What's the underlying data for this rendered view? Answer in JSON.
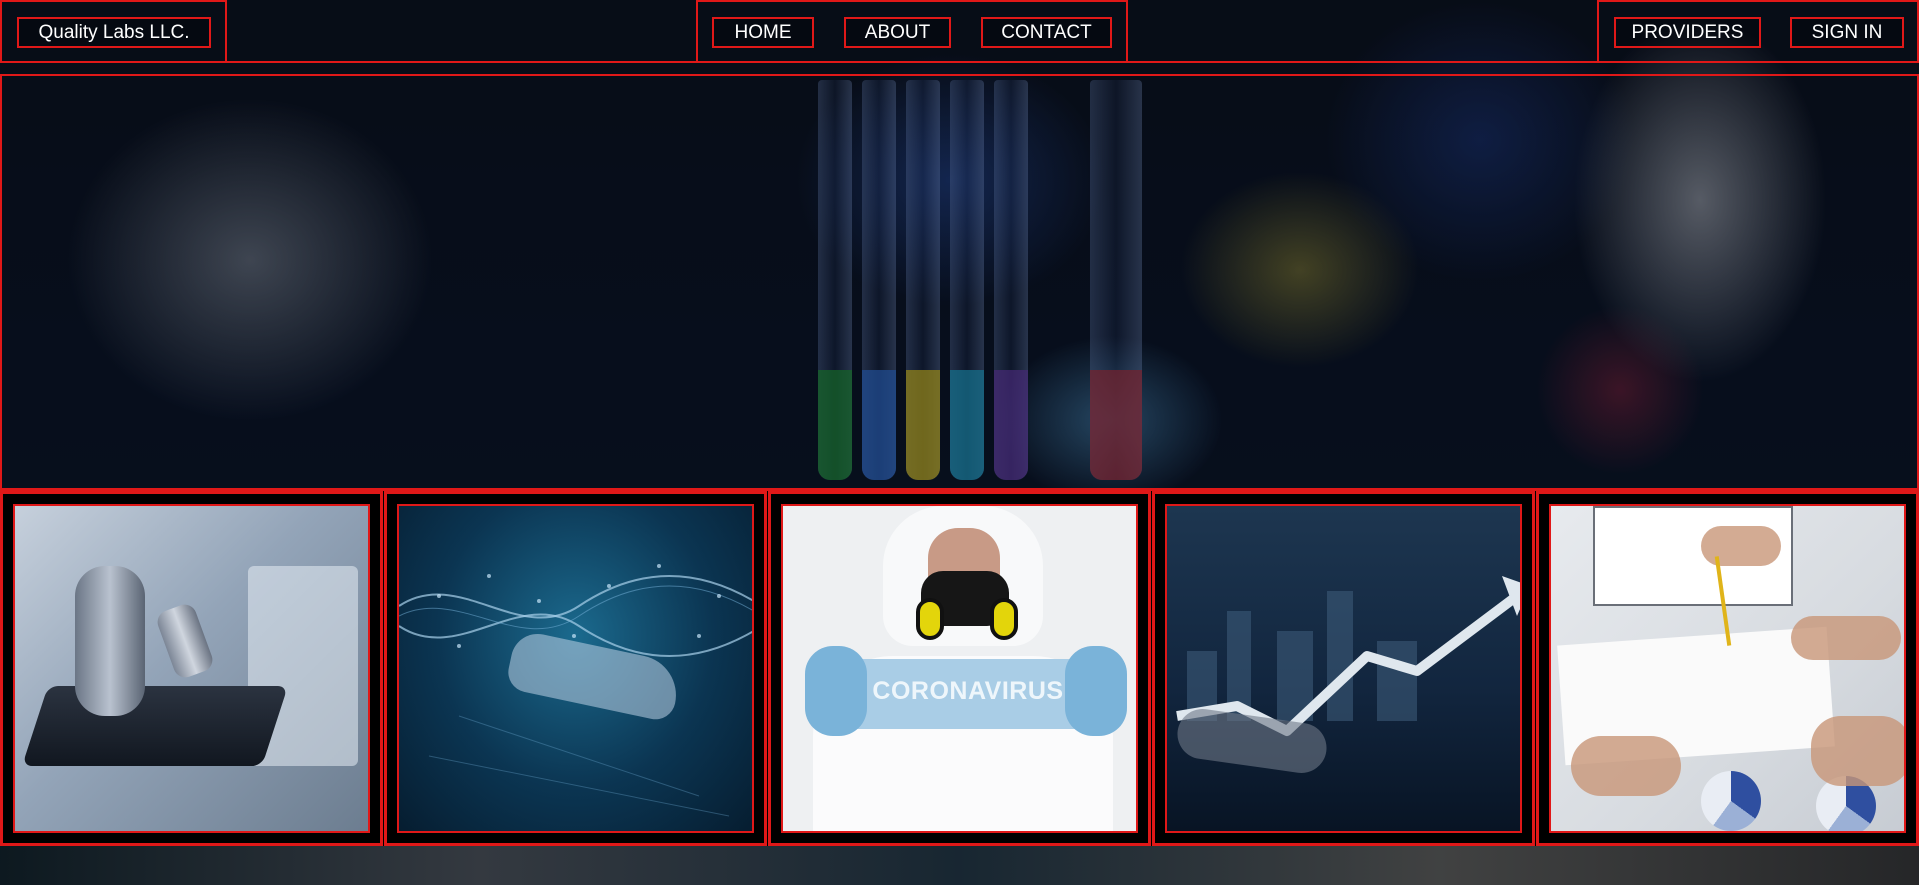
{
  "brand": {
    "label": "Quality Labs LLC."
  },
  "nav": {
    "home": "HOME",
    "about": "ABOUT",
    "contact": "CONTACT",
    "providers": "PROVIDERS",
    "sign_in": "SIGN IN"
  },
  "cards": [
    {
      "image": "microscope-image"
    },
    {
      "image": "dna-hand-image"
    },
    {
      "image": "coronavirus-image",
      "sign_text": "CORONAVIRUS"
    },
    {
      "image": "growth-arrow-image"
    },
    {
      "image": "charts-paperwork-image"
    }
  ],
  "colors": {
    "border_accent": "#e01818",
    "text": "#ffffff",
    "background": "#050608"
  }
}
